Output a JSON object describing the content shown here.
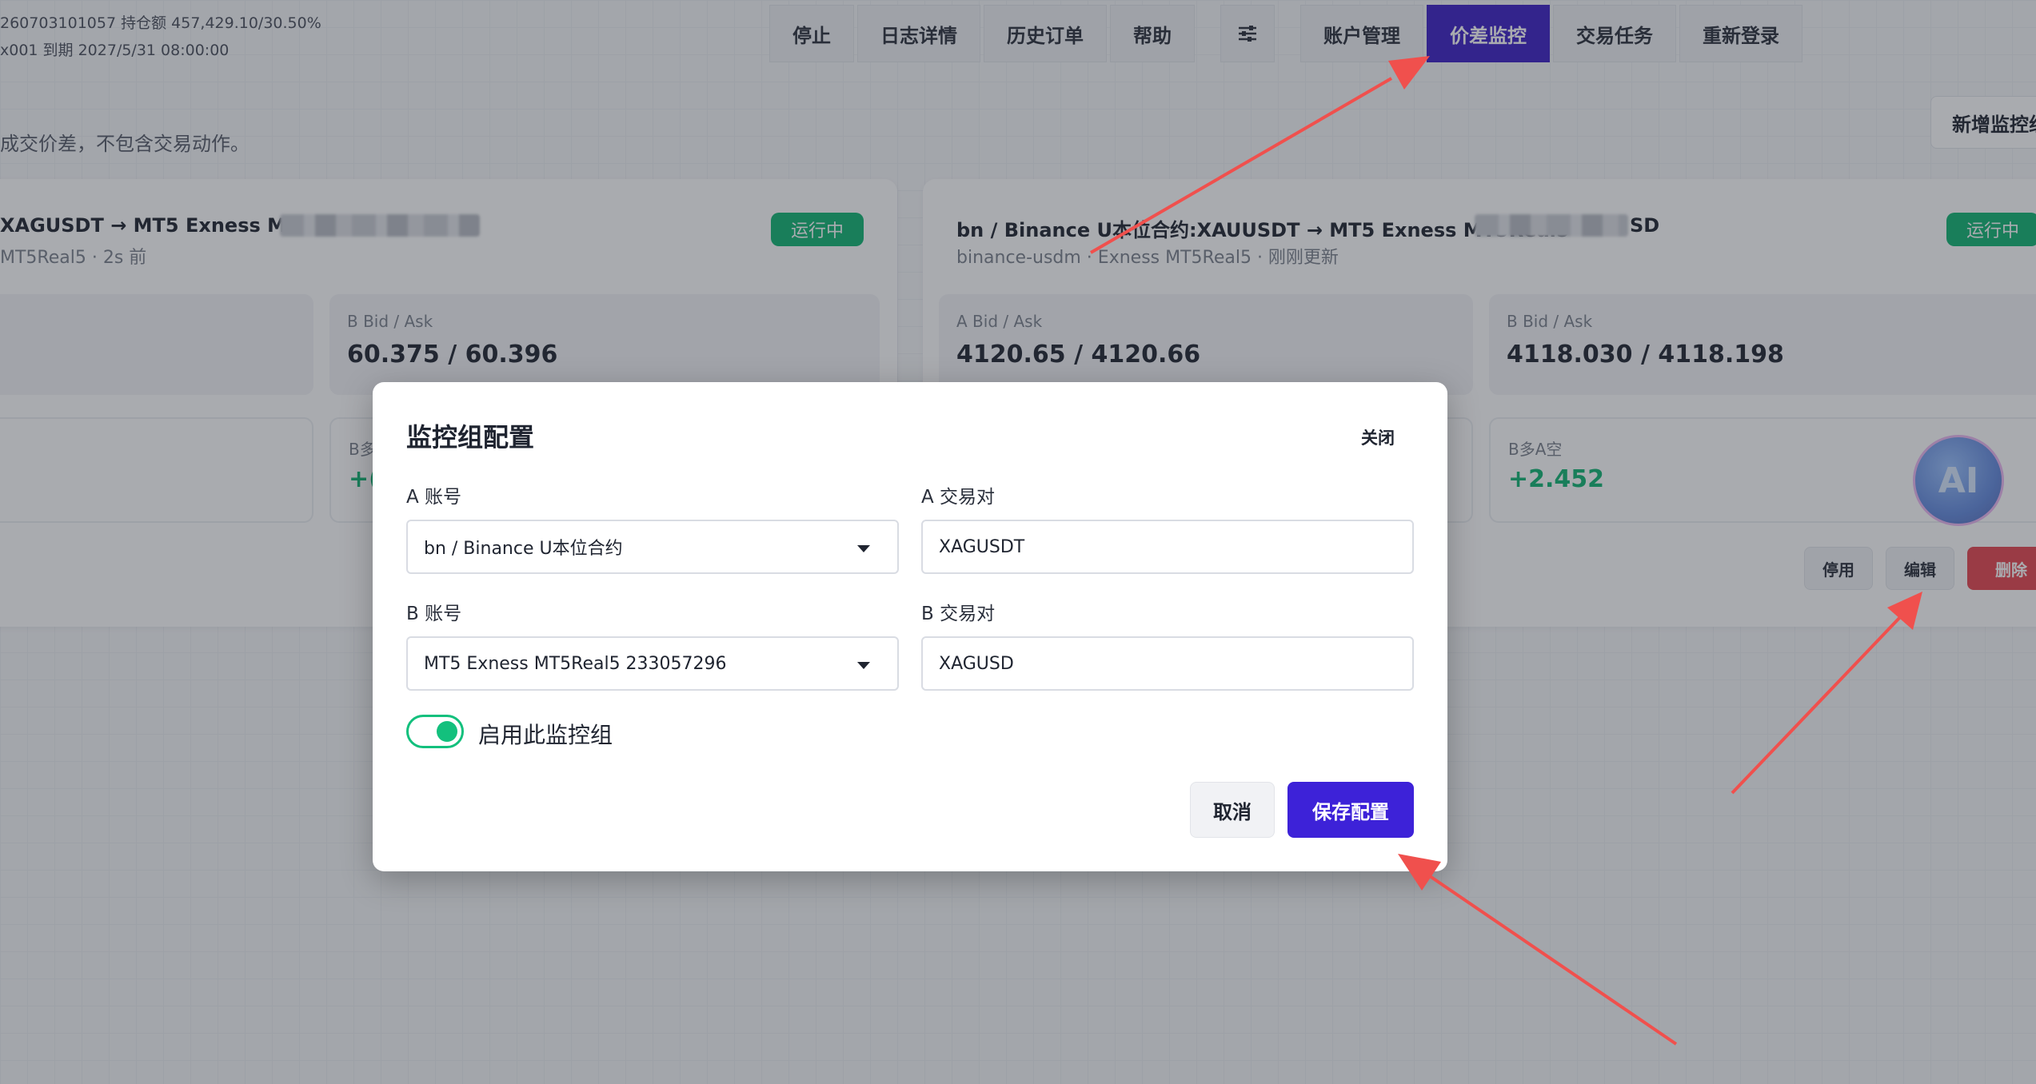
{
  "header": {
    "account_line1": "260703101057  持仓额 457,429.10/30.50%",
    "account_line2": "x001 到期 2027/5/31 08:00:00",
    "nav": {
      "stop": "停止",
      "log_detail": "日志详情",
      "history_orders": "历史订单",
      "help": "帮助",
      "settings_icon": "sliders-icon",
      "account_manage": "账户管理",
      "spread_monitor": "价差监控",
      "trade_tasks": "交易任务",
      "relogin": "重新登录"
    }
  },
  "main": {
    "intro": "成交价差，不包含交易动作。",
    "add_group": "新增监控组"
  },
  "cards": {
    "left": {
      "title": "XAGUSDT → MT5 Exness MT5Rea",
      "subtitle": "MT5Real5 · 2s 前",
      "status": "运行中",
      "b_label": "B Bid / Ask",
      "b_value": "60.375 / 60.396",
      "stat_label": "B多",
      "stat_value": "+("
    },
    "right": {
      "title": "bn / Binance U本位合约:XAUUSDT → MT5 Exness MT5Real5",
      "title_tail": "SD",
      "subtitle": "binance-usdm · Exness MT5Real5 · 刚刚更新",
      "status": "运行中",
      "a_label": "A Bid / Ask",
      "a_value": "4120.65 / 4120.66",
      "b_label": "B Bid / Ask",
      "b_value": "4118.030 / 4118.198",
      "spread_label": "B多A空",
      "spread_value": "+2.452",
      "disable": "停用",
      "edit": "编辑",
      "delete": "删除"
    }
  },
  "ai": {
    "label": "AI"
  },
  "modal": {
    "title": "监控组配置",
    "close": "关闭",
    "a_account_label": "A 账号",
    "a_account_value": "bn / Binance U本位合约",
    "a_pair_label": "A 交易对",
    "a_pair_value": "XAGUSDT",
    "b_account_label": "B 账号",
    "b_account_value": "MT5 Exness MT5Real5 233057296",
    "b_pair_label": "B 交易对",
    "b_pair_value": "XAGUSD",
    "enable_label": "启用此监控组",
    "enabled": true,
    "cancel": "取消",
    "save": "保存配置"
  },
  "colors": {
    "primary": "#3d22d8",
    "nav_active": "#3b1fc5",
    "success": "#0fb472",
    "danger": "#e7454f",
    "annotation_arrow": "#f0504d"
  }
}
